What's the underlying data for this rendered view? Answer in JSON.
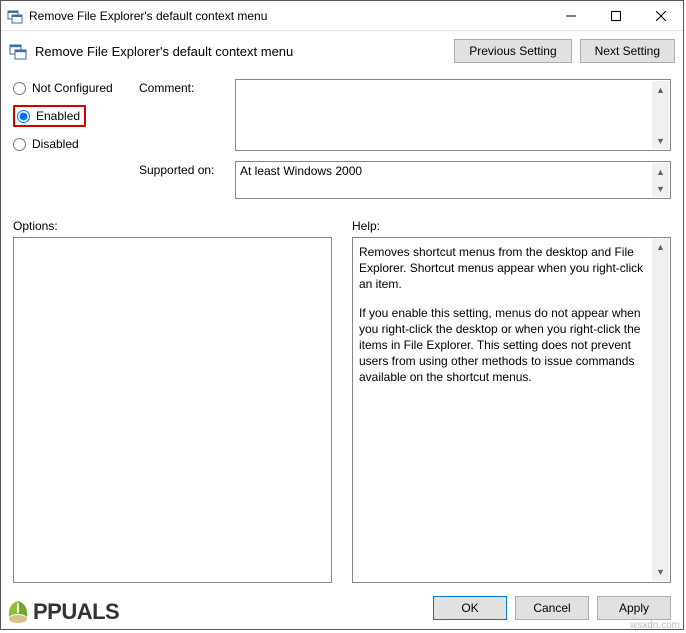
{
  "window": {
    "title": "Remove File Explorer's default context menu",
    "subtitle": "Remove File Explorer's default context menu"
  },
  "nav": {
    "previous": "Previous Setting",
    "next": "Next Setting"
  },
  "state": {
    "not_configured": "Not Configured",
    "enabled": "Enabled",
    "disabled": "Disabled",
    "selected": "enabled"
  },
  "labels": {
    "comment": "Comment:",
    "supported_on": "Supported on:",
    "options": "Options:",
    "help": "Help:"
  },
  "fields": {
    "comment": "",
    "supported_on": "At least Windows 2000"
  },
  "help": {
    "p1": "Removes shortcut menus from the desktop and File Explorer. Shortcut menus appear when you right-click an item.",
    "p2": "If you enable this setting, menus do not appear when you right-click the desktop or when you right-click the items in File Explorer. This setting does not prevent users from using other methods to issue commands available on the shortcut menus."
  },
  "buttons": {
    "ok": "OK",
    "cancel": "Cancel",
    "apply": "Apply"
  },
  "watermark": {
    "brand": "PPUALS",
    "source": "wsxdn.com"
  }
}
